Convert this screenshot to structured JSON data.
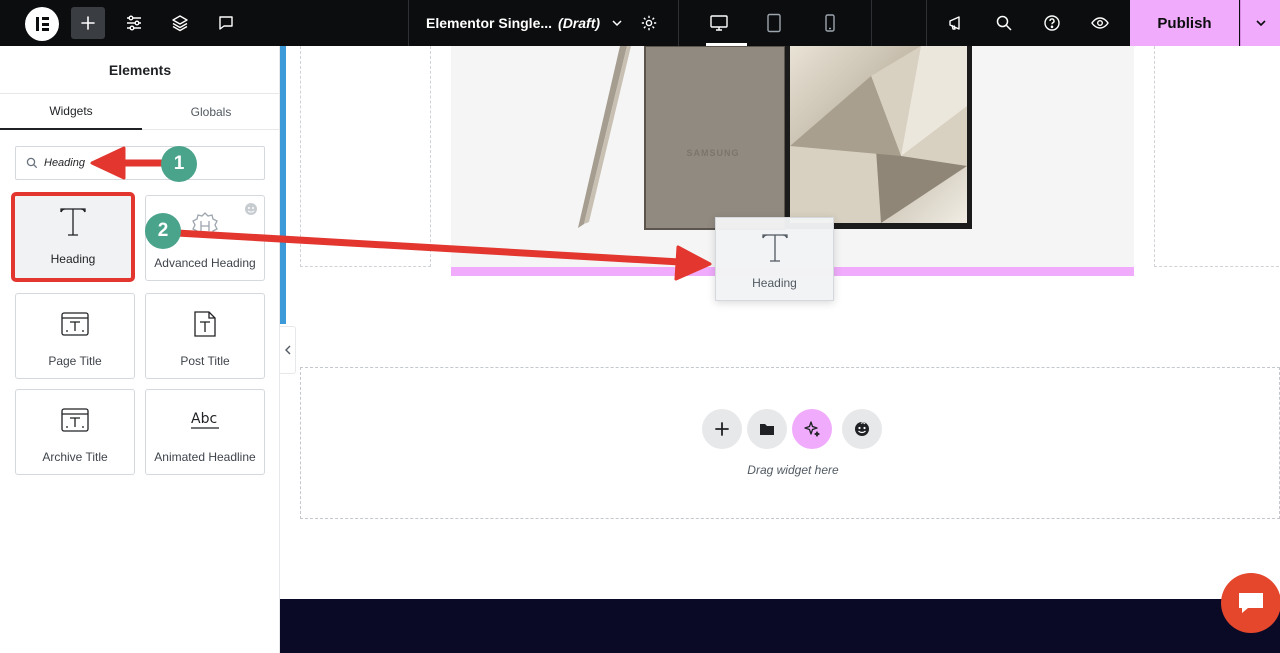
{
  "topbar": {
    "doc_title": "Elementor Single...",
    "draft_label": "(Draft)",
    "publish_label": "Publish"
  },
  "panel": {
    "title": "Elements",
    "tabs": [
      {
        "label": "Widgets",
        "active": true
      },
      {
        "label": "Globals",
        "active": false
      }
    ],
    "search": {
      "value": "Heading",
      "placeholder": "Search Widget..."
    },
    "widgets": [
      {
        "label": "Heading",
        "icon": "heading-icon",
        "highlighted": true
      },
      {
        "label": "Advanced Heading",
        "icon": "advanced-heading-icon",
        "pro": true
      },
      {
        "label": "Page Title",
        "icon": "page-title-icon"
      },
      {
        "label": "Post Title",
        "icon": "post-title-icon"
      },
      {
        "label": "Archive Title",
        "icon": "archive-title-icon"
      },
      {
        "label": "Animated Headline",
        "icon": "animated-headline-icon"
      }
    ]
  },
  "canvas": {
    "brand_text": "SAMSUNG",
    "drag_preview_label": "Heading",
    "drop_hint": "Drag widget here"
  },
  "annotations": {
    "step1": "1",
    "step2": "2"
  },
  "colors": {
    "accent_pink": "#f0abfc",
    "panel_edge": "#3d9ad9",
    "annotation_red": "#e2362f",
    "step_green": "#4aa38b",
    "footer": "#0b0a26"
  }
}
